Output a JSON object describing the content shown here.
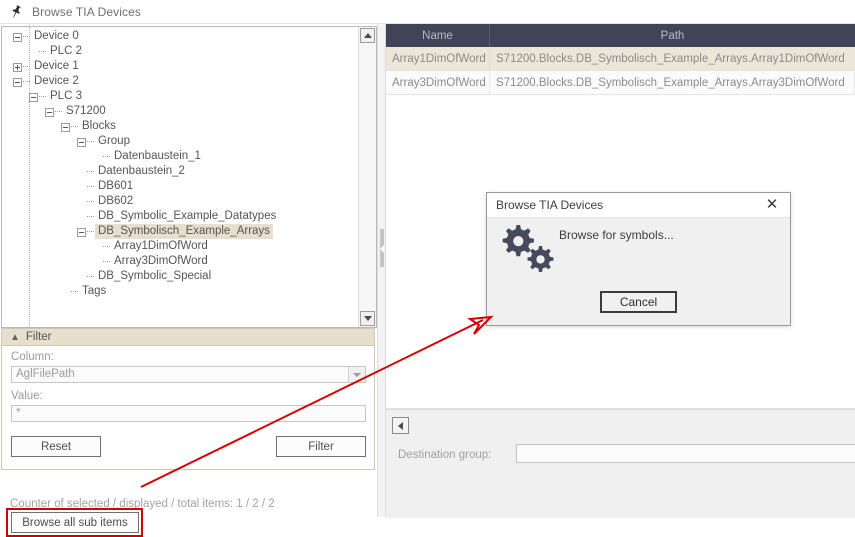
{
  "window": {
    "title": "Browse TIA Devices",
    "icon": "pin-icon"
  },
  "tree": {
    "nodes": [
      {
        "label": "Device 0",
        "depth": 1,
        "toggle": "minus",
        "selected": false
      },
      {
        "label": "PLC 2",
        "depth": 2,
        "toggle": "none",
        "selected": false
      },
      {
        "label": "Device 1",
        "depth": 1,
        "toggle": "plus",
        "selected": false
      },
      {
        "label": "Device 2",
        "depth": 1,
        "toggle": "minus",
        "selected": false
      },
      {
        "label": "PLC 3",
        "depth": 2,
        "toggle": "minus",
        "selected": false
      },
      {
        "label": "S71200",
        "depth": 3,
        "toggle": "minus",
        "selected": false
      },
      {
        "label": "Blocks",
        "depth": 4,
        "toggle": "minus",
        "selected": false
      },
      {
        "label": "Group",
        "depth": 5,
        "toggle": "minus",
        "selected": false
      },
      {
        "label": "Datenbaustein_1",
        "depth": 6,
        "toggle": "none",
        "selected": false
      },
      {
        "label": "Datenbaustein_2",
        "depth": 5,
        "toggle": "none",
        "selected": false
      },
      {
        "label": "DB601",
        "depth": 5,
        "toggle": "none",
        "selected": false
      },
      {
        "label": "DB602",
        "depth": 5,
        "toggle": "none",
        "selected": false
      },
      {
        "label": "DB_Symbolic_Example_Datatypes",
        "depth": 5,
        "toggle": "none",
        "selected": false
      },
      {
        "label": "DB_Symbolisch_Example_Arrays",
        "depth": 5,
        "toggle": "minus",
        "selected": true
      },
      {
        "label": "Array1DimOfWord",
        "depth": 6,
        "toggle": "none",
        "selected": false
      },
      {
        "label": "Array3DimOfWord",
        "depth": 6,
        "toggle": "none",
        "selected": false
      },
      {
        "label": "DB_Symbolic_Special",
        "depth": 5,
        "toggle": "none",
        "selected": false
      },
      {
        "label": "Tags",
        "depth": 4,
        "toggle": "none",
        "selected": false
      }
    ],
    "scrollbar": {
      "up_icon": "triangle-up-icon",
      "down_icon": "triangle-down-icon"
    }
  },
  "filter": {
    "header_label": "Filter",
    "collapse_icon": "chevron-up-icon",
    "column_label": "Column:",
    "column_value": "AglFilePath",
    "column_dropdown_icon": "chevron-down-icon",
    "value_label": "Value:",
    "value_value": "*",
    "reset_label": "Reset",
    "filter_label": "Filter"
  },
  "status": {
    "counter_text": "Counter of selected / displayed / total items: 1 / 2 / 2",
    "browse_all_label": "Browse all sub items",
    "highlight_color": "#d40000"
  },
  "grid": {
    "columns": [
      "Name",
      "Path"
    ],
    "rows": [
      {
        "name": "Array1DimOfWord",
        "path": "S71200.Blocks.DB_Symbolisch_Example_Arrays.Array1DimOfWord",
        "selected": true
      },
      {
        "name": "Array3DimOfWord",
        "path": "S71200.Blocks.DB_Symbolisch_Example_Arrays.Array3DimOfWord",
        "selected": false
      }
    ],
    "header_color": "#414457",
    "selected_row_color": "#ece6d8"
  },
  "bottom": {
    "collapse_icon": "triangle-left-icon",
    "destination_label": "Destination group:",
    "destination_value": ""
  },
  "dialog": {
    "title": "Browse TIA Devices",
    "close_icon": "close-icon",
    "gears_icon": "gears-icon",
    "message": "Browse for symbols...",
    "cancel_label": "Cancel"
  },
  "splitter": {
    "grip_icon": "splitter-grip-icon"
  }
}
